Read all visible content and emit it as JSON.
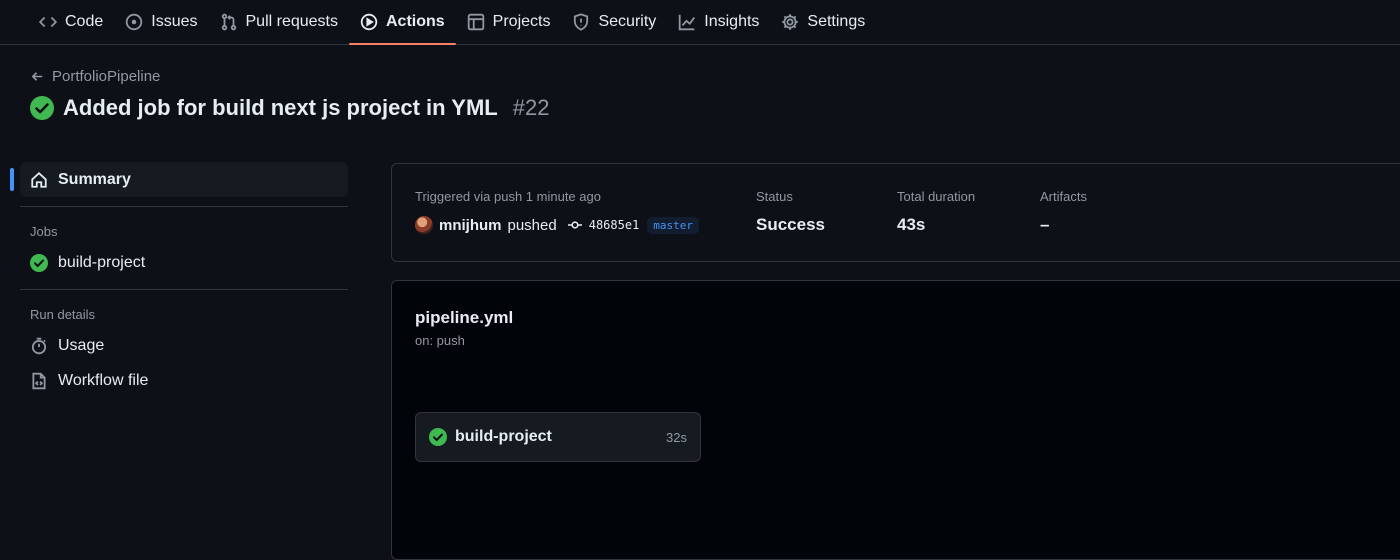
{
  "nav": {
    "tabs": [
      {
        "label": "Code",
        "icon": "code-icon"
      },
      {
        "label": "Issues",
        "icon": "issue-icon"
      },
      {
        "label": "Pull requests",
        "icon": "pull-request-icon"
      },
      {
        "label": "Actions",
        "icon": "play-icon",
        "active": true
      },
      {
        "label": "Projects",
        "icon": "table-icon"
      },
      {
        "label": "Security",
        "icon": "shield-icon"
      },
      {
        "label": "Insights",
        "icon": "graph-icon"
      },
      {
        "label": "Settings",
        "icon": "gear-icon"
      }
    ]
  },
  "header": {
    "back_label": "PortfolioPipeline",
    "title": "Added job for build next js project in YML",
    "run_number": "#22",
    "status_color": "#3fb950"
  },
  "sidebar": {
    "summary_label": "Summary",
    "jobs_heading": "Jobs",
    "jobs": [
      {
        "label": "build-project"
      }
    ],
    "run_details_heading": "Run details",
    "run_details": [
      {
        "label": "Usage",
        "icon": "stopwatch-icon"
      },
      {
        "label": "Workflow file",
        "icon": "file-code-icon"
      }
    ]
  },
  "summary": {
    "triggered_label": "Triggered via push 1 minute ago",
    "user": "mnijhum",
    "action": "pushed",
    "commit_sha": "48685e1",
    "branch": "master",
    "status_label": "Status",
    "status_value": "Success",
    "duration_label": "Total duration",
    "duration_value": "43s",
    "artifacts_label": "Artifacts",
    "artifacts_value": "–"
  },
  "workflow": {
    "file_name": "pipeline.yml",
    "trigger": "on: push",
    "job": {
      "label": "build-project",
      "duration": "32s"
    }
  },
  "colors": {
    "accent": "#f78166",
    "selected_bar": "#4493f8",
    "success": "#3fb950",
    "background": "#0d1117"
  }
}
